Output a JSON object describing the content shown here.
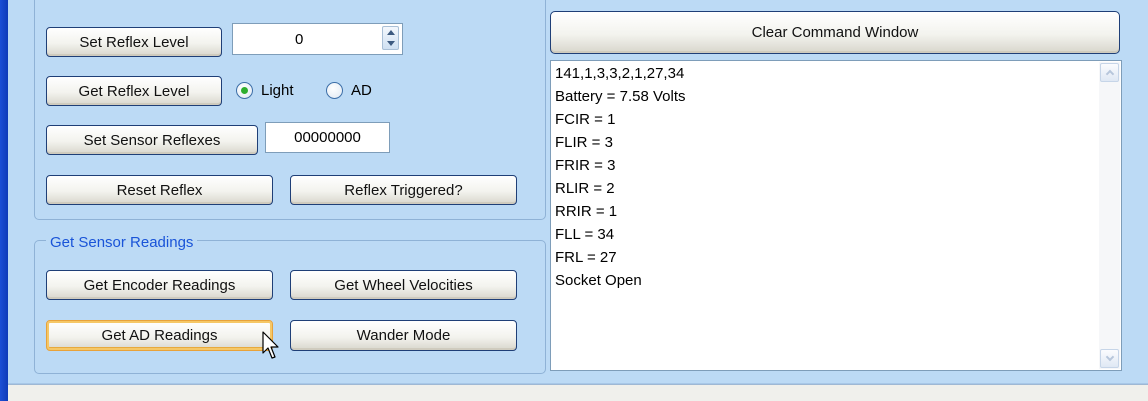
{
  "reflex": {
    "set_level_label": "Set Reflex Level",
    "level_value": "0",
    "get_level_label": "Get Reflex Level",
    "radio_light_label": "Light",
    "radio_ad_label": "AD",
    "selected_radio": "Light",
    "set_sensor_reflexes_label": "Set Sensor Reflexes",
    "sensor_reflexes_value": "00000000",
    "reset_label": "Reset Reflex",
    "triggered_label": "Reflex Triggered?"
  },
  "sensor_readings": {
    "group_title": "Get Sensor Readings",
    "encoder_label": "Get Encoder Readings",
    "wheel_velocities_label": "Get Wheel Velocities",
    "ad_readings_label": "Get AD Readings",
    "wander_label": "Wander Mode"
  },
  "command_window": {
    "clear_label": "Clear Command Window",
    "lines": [
      "141,1,3,3,2,1,27,34",
      "Battery = 7.58 Volts",
      "FCIR = 1",
      "FLIR = 3",
      "FRIR = 3",
      "RLIR = 2",
      "RRIR = 1",
      "FLL = 34",
      "FRL = 27",
      "Socket Open"
    ]
  },
  "colors": {
    "panel_bg": "#bcdaf5",
    "group_title": "#1a54d8",
    "radio_selected": "#2fae2f",
    "hover_border": "#e8a23a"
  },
  "icons": [
    "spinner-up-icon",
    "spinner-down-icon",
    "scroll-up-icon",
    "scroll-down-icon",
    "mouse-pointer-icon"
  ]
}
